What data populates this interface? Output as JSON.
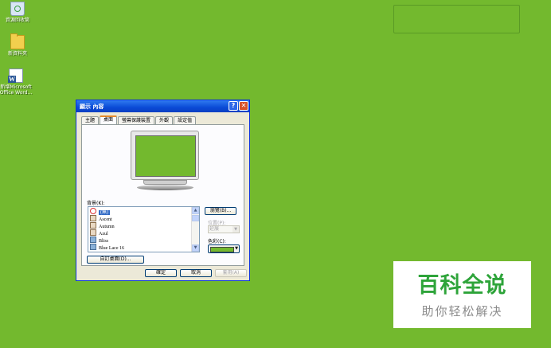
{
  "desktop": {
    "icons": [
      {
        "label": "資源回收筒",
        "icon": "recycle-bin-icon"
      },
      {
        "label": "新資料夾",
        "icon": "folder-icon"
      },
      {
        "label": "新增Microsoft\nOffice Word...",
        "icon": "word-document-icon"
      }
    ],
    "background_color": "#73b92e"
  },
  "dialog": {
    "title": "顯示 內容",
    "help_glyph": "?",
    "close_glyph": "✕",
    "tabs": [
      {
        "label": "主題",
        "active": false
      },
      {
        "label": "桌面",
        "active": true
      },
      {
        "label": "螢幕保護裝置",
        "active": false
      },
      {
        "label": "外觀",
        "active": false
      },
      {
        "label": "設定值",
        "active": false
      }
    ],
    "background_label": "背景(K):",
    "background_list": [
      {
        "label": "(無)",
        "icon": "none-icon",
        "selected": true
      },
      {
        "label": "Ascent",
        "icon": "image-file-icon",
        "selected": false
      },
      {
        "label": "Autumn",
        "icon": "image-file-icon",
        "selected": false
      },
      {
        "label": "Azul",
        "icon": "image-file-icon",
        "selected": false
      },
      {
        "label": "Bliss",
        "icon": "picture-icon",
        "selected": false
      },
      {
        "label": "Blue Lace 16",
        "icon": "picture-icon",
        "selected": false
      }
    ],
    "browse_button": "瀏覽(B)...",
    "position_label": "位置(P):",
    "position_value": "延展",
    "color_label": "色彩(C):",
    "color_value": "#73b92e",
    "customize_button": "自訂桌面(D)...",
    "ok_button": "確定",
    "cancel_button": "取消",
    "apply_button": "套用(A)"
  },
  "watermark": {
    "title": "百科全说",
    "subtitle": "助你轻松解决"
  }
}
